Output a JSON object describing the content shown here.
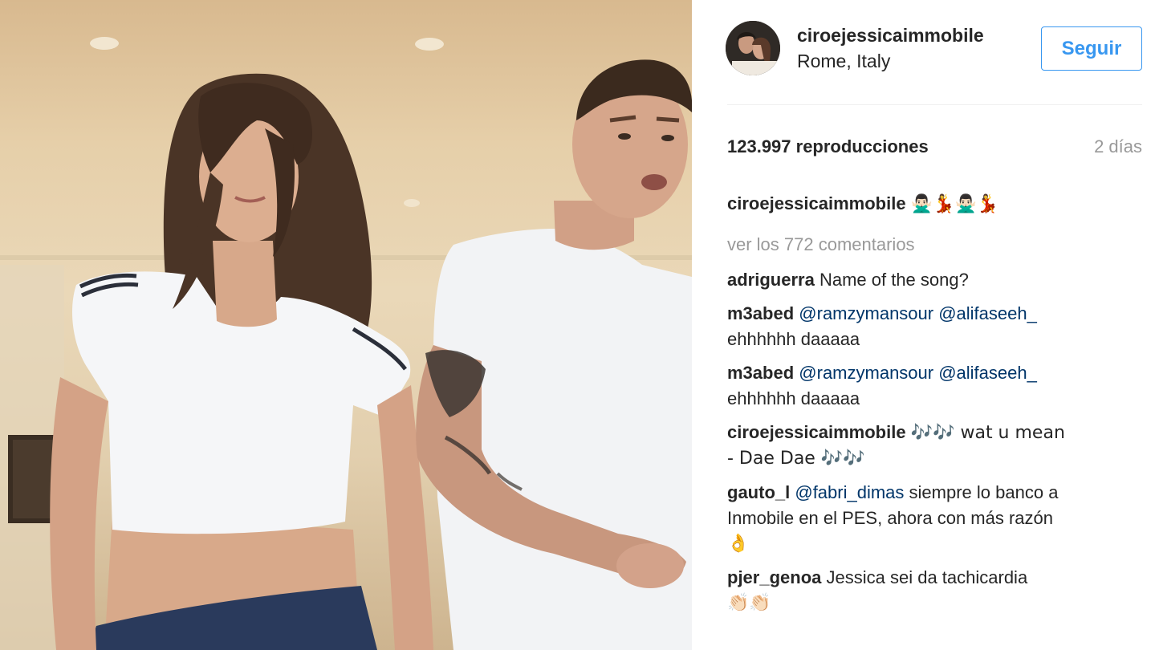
{
  "post": {
    "username": "ciroejessicaimmobile",
    "location": "Rome, Italy",
    "follow_label": "Seguir",
    "views": "123.997 reproducciones",
    "time_ago": "2 días"
  },
  "caption": {
    "user": "ciroejessicaimmobile",
    "text": "🙅🏻‍♂️💃🙅🏻‍♂️💃"
  },
  "view_all_comments": "ver los 772 comentarios",
  "comments": [
    {
      "user": "adriguerra",
      "pre": "",
      "mentions": "",
      "text": "Name of the song?",
      "line2": ""
    },
    {
      "user": "m3abed",
      "pre": "",
      "mentions": "@ramzymansour @alifaseeh_",
      "text": "",
      "line2": "ehhhhhh daaaaa"
    },
    {
      "user": "m3abed",
      "pre": "",
      "mentions": "@ramzymansour @alifaseeh_",
      "text": "",
      "line2": "ehhhhhh daaaaa"
    },
    {
      "user": "ciroejessicaimmobile",
      "pre": "",
      "mentions": "",
      "text": "🎶🎶 wat u mean",
      "line2": "- Dae Dae 🎶🎶"
    },
    {
      "user": "gauto_l",
      "pre": "",
      "mentions": "@fabri_dimas",
      "text": "siempre lo banco a",
      "line2": "Inmobile en el PES, ahora con más razón",
      "line3": "👌"
    },
    {
      "user": "pjer_genoa",
      "pre": "",
      "mentions": "",
      "text": "Jessica sei da tachicardia",
      "line2": "👏🏻👏🏻"
    }
  ],
  "colors": {
    "accent": "#3897f0",
    "mention": "#003569",
    "muted": "#999999",
    "text": "#262626"
  },
  "icons": [
    "avatar-photo"
  ]
}
